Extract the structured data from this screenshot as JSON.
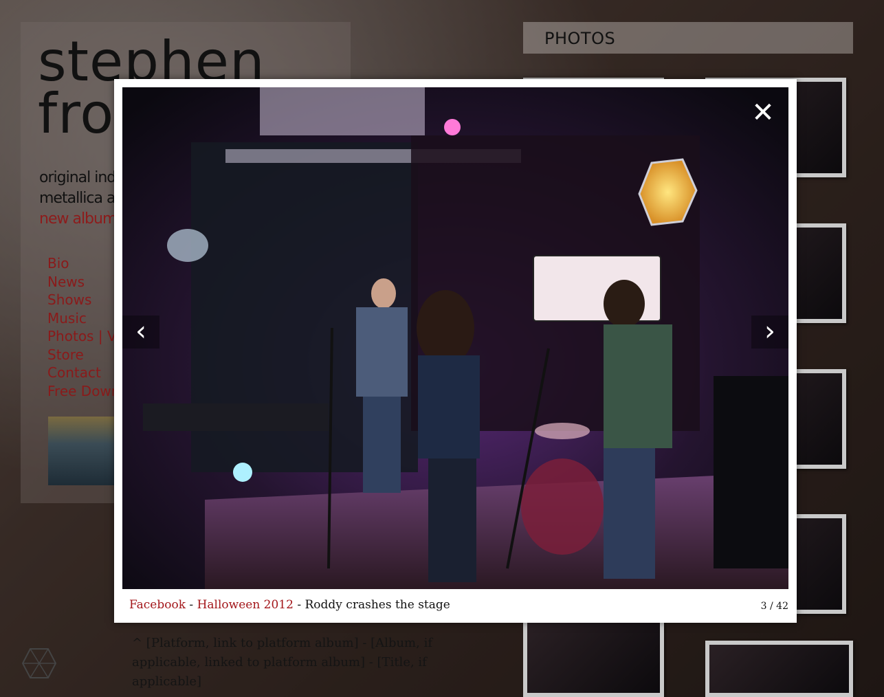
{
  "site": {
    "title_line1": "stephen",
    "title_line2": "fro",
    "tagline_line1": "original indi",
    "tagline_line2": "metallica an",
    "tagline_link": "new album"
  },
  "nav": [
    {
      "label": "Bio"
    },
    {
      "label": "News"
    },
    {
      "label": "Shows"
    },
    {
      "label": "Music"
    },
    {
      "label": "Photos | Vi"
    },
    {
      "label": "Store"
    },
    {
      "label": "Contact"
    },
    {
      "label": "Free Down"
    }
  ],
  "photos": {
    "header": "PHOTOS"
  },
  "caption_note": "^ [Platform, link to platform album] - [Album, if applicable, linked to platform album] - [Title, if applicable]",
  "lightbox": {
    "platform": "Facebook",
    "separator1": " - ",
    "album": "Halloween 2012",
    "separator2": " - ",
    "title": "Roddy crashes the stage",
    "counter": "3 / 42",
    "close_glyph": "✕",
    "prev_glyph": "‹",
    "next_glyph": "›",
    "icons": {
      "close": "close-icon",
      "prev": "chevron-left-icon",
      "next": "chevron-right-icon"
    }
  },
  "colors": {
    "link_red": "#a3161a",
    "nav_red": "#8a1a1a"
  }
}
